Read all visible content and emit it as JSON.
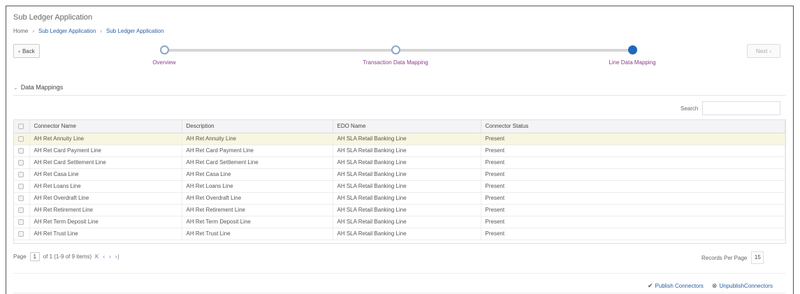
{
  "app": {
    "title": "Sub Ledger Application"
  },
  "breadcrumb": [
    "Home",
    "Sub Ledger Application",
    "Sub Ledger Application"
  ],
  "nav": {
    "back_label": "Back",
    "next_label": "Next"
  },
  "train": {
    "steps": [
      "Overview",
      "Transaction Data Mapping",
      "Line Data Mapping"
    ],
    "current_step": "Line Data Mapping"
  },
  "section": {
    "title": "Data Mappings"
  },
  "search": {
    "label": "Search",
    "value": ""
  },
  "table": {
    "columns": [
      "Connector Name",
      "Description",
      "EDO Name",
      "Connector Status"
    ],
    "rows": [
      [
        "AH Ret Annuity Line",
        "AH Ret Annuity Line",
        "AH SLA Retail Banking Line",
        "Present"
      ],
      [
        "AH Ret Card Payment Line",
        "AH Ret Card Payment Line",
        "AH SLA Retail Banking Line",
        "Present"
      ],
      [
        "AH Ret Card Settlement Line",
        "AH Ret Card Settlement Line",
        "AH SLA Retail Banking Line",
        "Present"
      ],
      [
        "AH Ret Casa Line",
        "AH Ret Casa Line",
        "AH SLA Retail Banking Line",
        "Present"
      ],
      [
        "AH Ret Loans Line",
        "AH Ret Loans Line",
        "AH SLA Retail Banking Line",
        "Present"
      ],
      [
        "AH Ret Overdraft Line",
        "AH Ret Overdraft Line",
        "AH SLA Retail Banking Line",
        "Present"
      ],
      [
        "AH Ret Retirement Line",
        "AH Ret Retirement Line",
        "AH SLA Retail Banking Line",
        "Present"
      ],
      [
        "AH Ret Term Deposit Line",
        "AH Ret Term Deposit Line",
        "AH SLA Retail Banking Line",
        "Present"
      ],
      [
        "AH Ret Trust Line",
        "AH Ret Trust Line",
        "AH SLA Retail Banking Line",
        "Present"
      ]
    ],
    "selected_row": 0
  },
  "pager": {
    "page_label": "Page",
    "page": "1",
    "summary": "of 1 (1-9 of 9 items)"
  },
  "records_per_page": {
    "label": "Records Per Page",
    "value": "15"
  },
  "actions": {
    "publish": "Publish Connectors",
    "unpublish": "UnpublishConnectors"
  },
  "colors": {
    "link": "#2a5d9f",
    "step_label": "#8a3d8a",
    "current_step": "#2068b8",
    "selected_row": "#f8f6e0"
  }
}
